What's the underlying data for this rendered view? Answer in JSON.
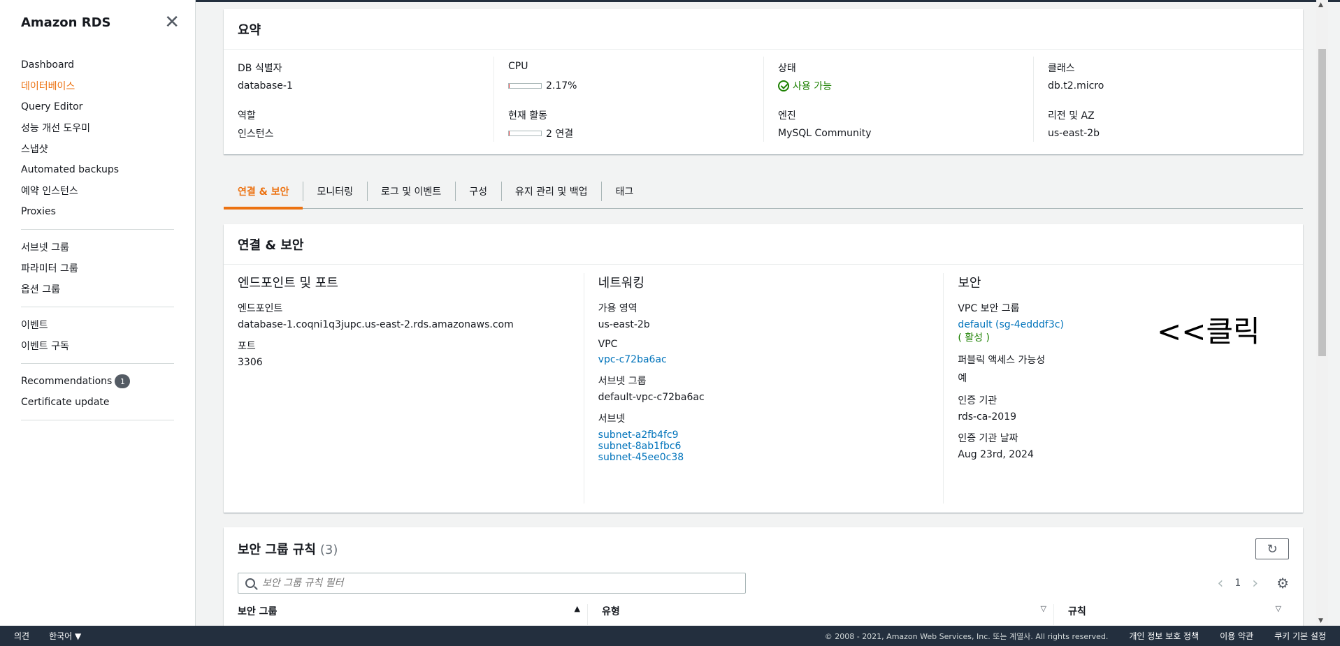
{
  "sidebar": {
    "title": "Amazon RDS",
    "groups": [
      [
        {
          "label": "Dashboard"
        },
        {
          "label": "데이터베이스",
          "active": true
        },
        {
          "label": "Query Editor"
        },
        {
          "label": "성능 개선 도우미"
        },
        {
          "label": "스냅샷"
        },
        {
          "label": "Automated backups"
        },
        {
          "label": "예약 인스턴스"
        },
        {
          "label": "Proxies"
        }
      ],
      [
        {
          "label": "서브넷 그룹"
        },
        {
          "label": "파라미터 그룹"
        },
        {
          "label": "옵션 그룹"
        }
      ],
      [
        {
          "label": "이벤트"
        },
        {
          "label": "이벤트 구독"
        }
      ],
      [
        {
          "label": "Recommendations",
          "badge": "1"
        },
        {
          "label": "Certificate update"
        }
      ]
    ]
  },
  "summary": {
    "title": "요약",
    "db_id_label": "DB 식별자",
    "db_id": "database-1",
    "role_label": "역할",
    "role": "인스턴스",
    "cpu_label": "CPU",
    "cpu": "2.17%",
    "cpu_fraction": 0.0217,
    "activity_label": "현재 활동",
    "activity": "2 연결",
    "activity_fraction": 0.02,
    "status_label": "상태",
    "status": "사용 가능",
    "engine_label": "엔진",
    "engine": "MySQL Community",
    "class_label": "클래스",
    "class": "db.t2.micro",
    "region_label": "리전 및 AZ",
    "region": "us-east-2b"
  },
  "tabs": [
    {
      "label": "연결 & 보안",
      "active": true
    },
    {
      "label": "모니터링"
    },
    {
      "label": "로그 및 이벤트"
    },
    {
      "label": "구성"
    },
    {
      "label": "유지 관리 및 백업"
    },
    {
      "label": "태그"
    }
  ],
  "connectivity": {
    "title": "연결 & 보안",
    "endpoint": {
      "title": "엔드포인트 및 포트",
      "endpoint_label": "엔드포인트",
      "endpoint": "database-1.coqni1q3jupc.us-east-2.rds.amazonaws.com",
      "port_label": "포트",
      "port": "3306"
    },
    "networking": {
      "title": "네트워킹",
      "az_label": "가용 영역",
      "az": "us-east-2b",
      "vpc_label": "VPC",
      "vpc": "vpc-c72ba6ac",
      "subnet_group_label": "서브넷 그룹",
      "subnet_group": "default-vpc-c72ba6ac",
      "subnets_label": "서브넷",
      "subnets": [
        "subnet-a2fb4fc9",
        "subnet-8ab1fbc6",
        "subnet-45ee0c38"
      ]
    },
    "security": {
      "title": "보안",
      "sg_label": "VPC 보안 그룹",
      "sg": "default (sg-4edddf3c)",
      "sg_status": "( 활성 )",
      "public_label": "퍼블릭 액세스 가능성",
      "public": "예",
      "ca_label": "인증 기관",
      "ca": "rds-ca-2019",
      "ca_date_label": "인증 기관 날짜",
      "ca_date": "Aug 23rd, 2024"
    },
    "annotation": "<<클릭"
  },
  "rules": {
    "title": "보안 그룹 규칙",
    "count": "(3)",
    "search_placeholder": "보안 그룹 규칙 필터",
    "page": "1",
    "columns": [
      "보안 그룹",
      "유형",
      "규칙"
    ]
  },
  "footer": {
    "feedback": "의견",
    "language": "한국어",
    "copyright": "© 2008 - 2021, Amazon Web Services, Inc. 또는 계열사. All rights reserved.",
    "privacy": "개인 정보 보호 정책",
    "terms": "이용 약관",
    "cookies": "쿠키 기본 설정"
  }
}
